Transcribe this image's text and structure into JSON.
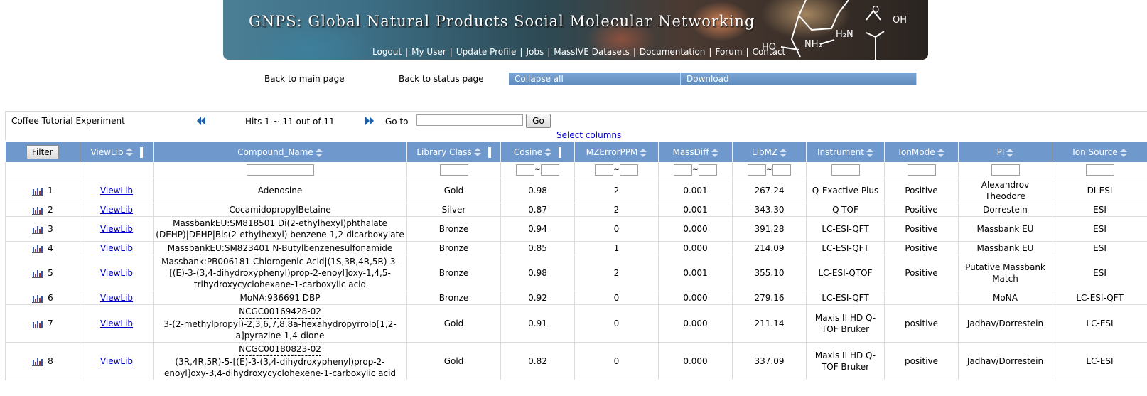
{
  "banner": {
    "title": "GNPS: Global Natural Products Social Molecular Networking",
    "molecule_labels": {
      "oh": "OH",
      "o": "O",
      "h2n": "H₂N",
      "ho": "HO",
      "nh2": "NH₂"
    },
    "nav_links": [
      "Logout",
      "My User",
      "Update Profile",
      "Jobs",
      "MassIVE Datasets",
      "Documentation",
      "Forum",
      "Contact"
    ]
  },
  "actions": {
    "back_main": "Back to main page",
    "back_status": "Back to status page",
    "collapse_all": "Collapse all",
    "download": "Download"
  },
  "toolbar": {
    "experiment_title": "Coffee Tutorial Experiment",
    "hits": "Hits 1 ~ 11 out of 11",
    "goto_label": "Go to",
    "goto_value": "",
    "go_button": "Go",
    "select_columns": "Select columns"
  },
  "table": {
    "filter_button": "Filter",
    "headers": [
      "ViewLib",
      "Compound_Name",
      "Library Class",
      "Cosine",
      "MZErrorPPM",
      "MassDiff",
      "LibMZ",
      "Instrument",
      "IonMode",
      "PI",
      "Ion Source"
    ],
    "range_separator": "~",
    "rows": [
      {
        "num": "1",
        "viewlib": "ViewLib",
        "compound": "Adenosine",
        "compound_sub": "",
        "library_class": "Gold",
        "cosine": "0.98",
        "mzerror": "2",
        "massdiff": "0.001",
        "libmz": "267.24",
        "instrument": "Q-Exactive Plus",
        "ionmode": "Positive",
        "pi": "Alexandrov Theodore",
        "ion_source": "DI-ESI"
      },
      {
        "num": "2",
        "viewlib": "ViewLib",
        "compound": "CocamidopropylBetaine",
        "compound_sub": "",
        "library_class": "Silver",
        "cosine": "0.87",
        "mzerror": "2",
        "massdiff": "0.001",
        "libmz": "343.30",
        "instrument": "Q-TOF",
        "ionmode": "Positive",
        "pi": "Dorrestein",
        "ion_source": "ESI"
      },
      {
        "num": "3",
        "viewlib": "ViewLib",
        "compound": "MassbankEU:SM818501 Di(2-ethylhexyl)phthalate (DEHP)|DEHP|Bis(2-ethylhexyl) benzene-1,2-dicarboxylate",
        "compound_sub": "",
        "library_class": "Bronze",
        "cosine": "0.94",
        "mzerror": "0",
        "massdiff": "0.000",
        "libmz": "391.28",
        "instrument": "LC-ESI-QFT",
        "ionmode": "Positive",
        "pi": "Massbank EU",
        "ion_source": "ESI"
      },
      {
        "num": "4",
        "viewlib": "ViewLib",
        "compound": "MassbankEU:SM823401 N-Butylbenzenesulfonamide",
        "compound_sub": "",
        "library_class": "Bronze",
        "cosine": "0.85",
        "mzerror": "1",
        "massdiff": "0.000",
        "libmz": "214.09",
        "instrument": "LC-ESI-QFT",
        "ionmode": "Positive",
        "pi": "Massbank EU",
        "ion_source": "ESI"
      },
      {
        "num": "5",
        "viewlib": "ViewLib",
        "compound": "Massbank:PB006181 Chlorogenic Acid|(1S,3R,4R,5R)-3-[(E)-3-(3,4-dihydroxyphenyl)prop-2-enoyl]oxy-1,4,5-trihydroxycyclohexane-1-carboxylic acid",
        "compound_sub": "",
        "library_class": "Bronze",
        "cosine": "0.98",
        "mzerror": "2",
        "massdiff": "0.001",
        "libmz": "355.10",
        "instrument": "LC-ESI-QTOF",
        "ionmode": "Positive",
        "pi": "Putative Massbank Match",
        "ion_source": "ESI"
      },
      {
        "num": "6",
        "viewlib": "ViewLib",
        "compound": "MoNA:936691 DBP",
        "compound_sub": "",
        "library_class": "Bronze",
        "cosine": "0.92",
        "mzerror": "0",
        "massdiff": "0.000",
        "libmz": "279.16",
        "instrument": "LC-ESI-QFT",
        "ionmode": "",
        "pi": "MoNA",
        "ion_source": "LC-ESI-QFT"
      },
      {
        "num": "7",
        "viewlib": "ViewLib",
        "compound": "NCGC00169428-02",
        "compound_sub": "3-(2-methylpropyl)-2,3,6,7,8,8a-hexahydropyrrolo[1,2-a]pyrazine-1,4-dione",
        "library_class": "Gold",
        "cosine": "0.91",
        "mzerror": "0",
        "massdiff": "0.000",
        "libmz": "211.14",
        "instrument": "Maxis II HD Q-TOF Bruker",
        "ionmode": "positive",
        "pi": "Jadhav/Dorrestein",
        "ion_source": "LC-ESI"
      },
      {
        "num": "8",
        "viewlib": "ViewLib",
        "compound": "NCGC00180823-02",
        "compound_sub": "(3R,4R,5R)-5-[(E)-3-(3,4-dihydroxyphenyl)prop-2-enoyl]oxy-3,4-dihydroxycyclohexene-1-carboxylic acid",
        "library_class": "Gold",
        "cosine": "0.82",
        "mzerror": "0",
        "massdiff": "0.000",
        "libmz": "337.09",
        "instrument": "Maxis II HD Q-TOF Bruker",
        "ionmode": "positive",
        "pi": "Jadhav/Dorrestein",
        "ion_source": "LC-ESI"
      }
    ]
  },
  "colors": {
    "header_blue": "#6f99cc",
    "button_blue": "#6a95c8",
    "link_blue": "#0000cc",
    "pagination_arrow": "#1f5fa8"
  }
}
